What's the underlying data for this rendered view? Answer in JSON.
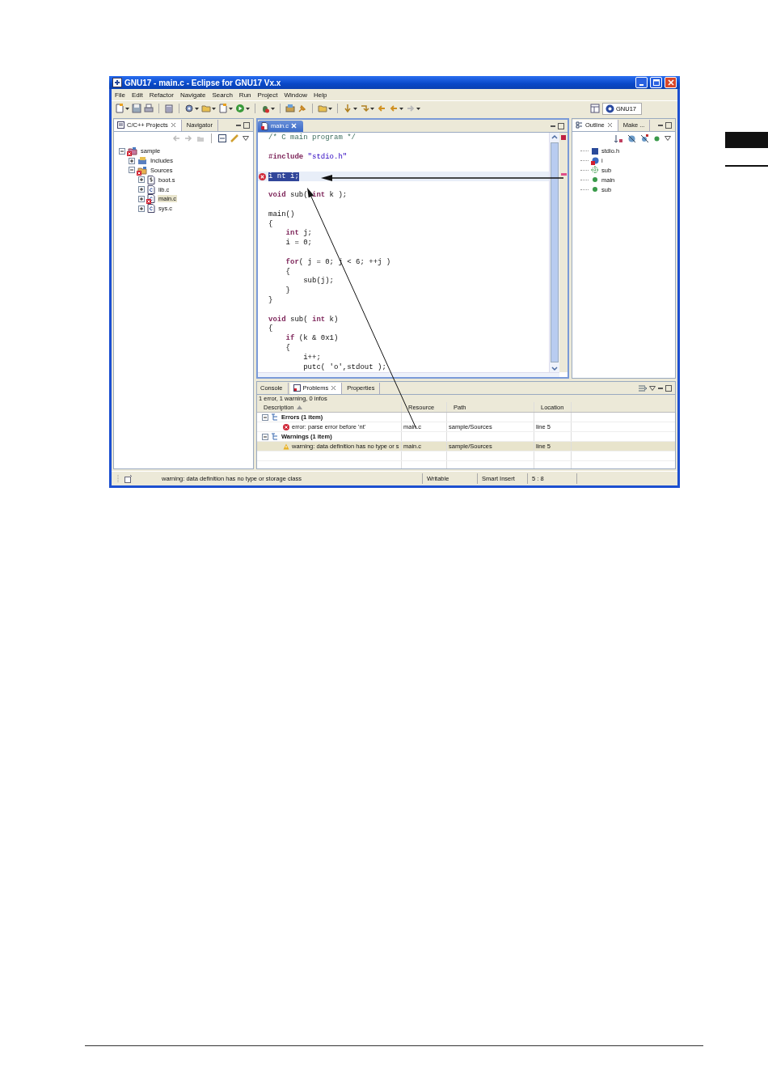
{
  "window": {
    "title": "GNU17 - main.c - Eclipse for GNU17 Vx.x"
  },
  "menu": [
    "File",
    "Edit",
    "Refactor",
    "Navigate",
    "Search",
    "Run",
    "Project",
    "Window",
    "Help"
  ],
  "perspective": {
    "label": "GNU17"
  },
  "project_panel": {
    "tabs": [
      {
        "label": "C/C++ Projects",
        "selected": true
      },
      {
        "label": "Navigator",
        "selected": false
      }
    ],
    "tree": [
      {
        "label": "sample",
        "kind": "project",
        "expanded": true,
        "error": true,
        "selected": false,
        "children": [
          {
            "label": "Includes",
            "kind": "includes",
            "expanded": false,
            "error": false,
            "selected": false
          },
          {
            "label": "Sources",
            "kind": "folder",
            "expanded": true,
            "error": true,
            "selected": false,
            "children": [
              {
                "label": "boot.s",
                "kind": "asm",
                "expanded": false,
                "error": false,
                "selected": false
              },
              {
                "label": "lib.c",
                "kind": "c",
                "expanded": false,
                "error": false,
                "selected": false
              },
              {
                "label": "main.c",
                "kind": "c",
                "expanded": false,
                "error": true,
                "selected": true
              },
              {
                "label": "sys.c",
                "kind": "c",
                "expanded": false,
                "error": false,
                "selected": false
              }
            ]
          }
        ]
      }
    ]
  },
  "editor": {
    "tabs": [
      {
        "label": "main.c",
        "selected": true
      }
    ],
    "lines": [
      {
        "kind": "code",
        "current": false,
        "error": false,
        "tokens": [
          {
            "kind": "comment",
            "text": "/* C main program */"
          }
        ]
      },
      {
        "kind": "blank",
        "current": false,
        "error": false
      },
      {
        "kind": "code",
        "current": false,
        "error": false,
        "tokens": [
          {
            "kind": "keyword",
            "text": "#include"
          },
          {
            "kind": "string",
            "text": " \"stdio.h\""
          }
        ]
      },
      {
        "kind": "blank",
        "current": false,
        "error": false
      },
      {
        "kind": "code",
        "current": true,
        "error": true,
        "tokens": [
          {
            "kind": "plain",
            "text": "i nt i;"
          }
        ]
      },
      {
        "kind": "blank",
        "current": false,
        "error": false
      },
      {
        "kind": "code",
        "current": false,
        "error": false,
        "tokens": [
          {
            "kind": "keyword",
            "text": "void"
          },
          {
            "kind": "plain",
            "text": " sub( "
          },
          {
            "kind": "keyword",
            "text": "int"
          },
          {
            "kind": "plain",
            "text": " k );"
          }
        ]
      },
      {
        "kind": "blank",
        "current": false,
        "error": false
      },
      {
        "kind": "code",
        "current": false,
        "error": false,
        "tokens": [
          {
            "kind": "plain",
            "text": "main()"
          }
        ]
      },
      {
        "kind": "code",
        "current": false,
        "error": false,
        "tokens": [
          {
            "kind": "plain",
            "text": "{"
          }
        ]
      },
      {
        "kind": "code",
        "current": false,
        "error": false,
        "tokens": [
          {
            "kind": "keyword",
            "text": "    int"
          },
          {
            "kind": "plain",
            "text": " j;"
          }
        ]
      },
      {
        "kind": "code",
        "current": false,
        "error": false,
        "tokens": [
          {
            "kind": "plain",
            "text": "    i = 0;"
          }
        ]
      },
      {
        "kind": "blank",
        "current": false,
        "error": false
      },
      {
        "kind": "code",
        "current": false,
        "error": false,
        "tokens": [
          {
            "kind": "keyword",
            "text": "    for"
          },
          {
            "kind": "plain",
            "text": "( j = 0; j < 6; ++j )"
          }
        ]
      },
      {
        "kind": "code",
        "current": false,
        "error": false,
        "tokens": [
          {
            "kind": "plain",
            "text": "    {"
          }
        ]
      },
      {
        "kind": "code",
        "current": false,
        "error": false,
        "tokens": [
          {
            "kind": "plain",
            "text": "        sub(j);"
          }
        ]
      },
      {
        "kind": "code",
        "current": false,
        "error": false,
        "tokens": [
          {
            "kind": "plain",
            "text": "    }"
          }
        ]
      },
      {
        "kind": "code",
        "current": false,
        "error": false,
        "tokens": [
          {
            "kind": "plain",
            "text": "}"
          }
        ]
      },
      {
        "kind": "blank",
        "current": false,
        "error": false
      },
      {
        "kind": "code",
        "current": false,
        "error": false,
        "tokens": [
          {
            "kind": "keyword",
            "text": "void"
          },
          {
            "kind": "plain",
            "text": " sub( "
          },
          {
            "kind": "keyword",
            "text": "int"
          },
          {
            "kind": "plain",
            "text": " k)"
          }
        ]
      },
      {
        "kind": "code",
        "current": false,
        "error": false,
        "tokens": [
          {
            "kind": "plain",
            "text": "{"
          }
        ]
      },
      {
        "kind": "code",
        "current": false,
        "error": false,
        "tokens": [
          {
            "kind": "keyword",
            "text": "    if"
          },
          {
            "kind": "plain",
            "text": " (k & 0x1)"
          }
        ]
      },
      {
        "kind": "code",
        "current": false,
        "error": false,
        "tokens": [
          {
            "kind": "plain",
            "text": "    {"
          }
        ]
      },
      {
        "kind": "code",
        "current": false,
        "error": false,
        "tokens": [
          {
            "kind": "plain",
            "text": "        i++;"
          }
        ]
      },
      {
        "kind": "code",
        "current": false,
        "error": false,
        "tokens": [
          {
            "kind": "plain",
            "text": "        putc( 'o',stdout );"
          }
        ]
      }
    ]
  },
  "outline": {
    "tabs": [
      {
        "label": "Outline",
        "selected": true
      },
      {
        "label": "Make ...",
        "selected": false
      }
    ],
    "items": [
      {
        "label": "stdio.h",
        "kind": "include"
      },
      {
        "label": "i",
        "kind": "variable"
      },
      {
        "label": "sub",
        "kind": "declaration"
      },
      {
        "label": "main",
        "kind": "function"
      },
      {
        "label": "sub",
        "kind": "function"
      }
    ]
  },
  "problems": {
    "tabs": [
      {
        "label": "Console",
        "selected": false
      },
      {
        "label": "Problems",
        "selected": true
      },
      {
        "label": "Properties",
        "selected": false
      }
    ],
    "summary": "1 error, 1 warning, 0 infos",
    "columns": [
      {
        "label": "Description",
        "sorted": true
      },
      {
        "label": "Resource",
        "sorted": false
      },
      {
        "label": "Path",
        "sorted": false
      },
      {
        "label": "Location",
        "sorted": false
      }
    ],
    "groups": [
      {
        "label": "Errors (1 item)",
        "expanded": true,
        "rows": [
          {
            "kind": "error",
            "description": "error: parse error before 'nt'",
            "resource": "main.c",
            "path": "sample/Sources",
            "location": "line 5",
            "selected": false
          }
        ]
      },
      {
        "label": "Warnings (1 item)",
        "expanded": true,
        "rows": [
          {
            "kind": "warning",
            "description": "warning: data definition has no type or s",
            "resource": "main.c",
            "path": "sample/Sources",
            "location": "line 5",
            "selected": true
          }
        ]
      }
    ]
  },
  "status_bar": {
    "message": "warning: data definition has no type or storage class",
    "mode": "Writable",
    "insert_mode": "Smart Insert",
    "position": "5 : 8"
  }
}
